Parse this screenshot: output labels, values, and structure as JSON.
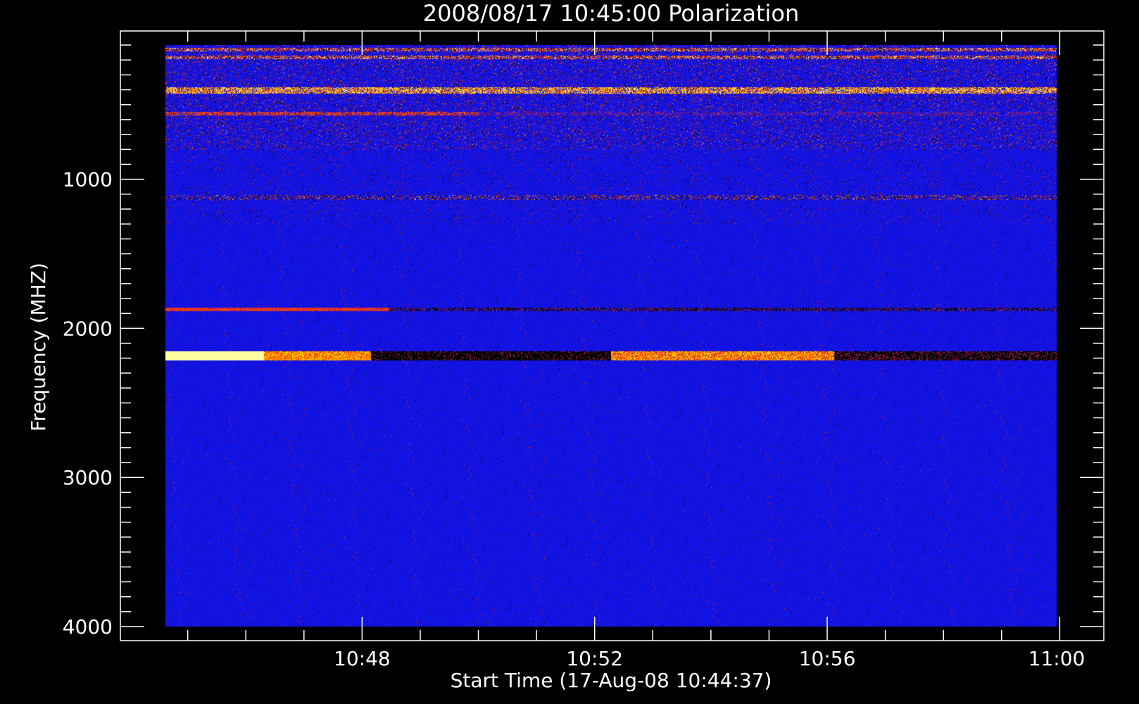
{
  "chart_data": {
    "type": "heatmap",
    "title": "2008/08/17 10:45:00 Polarization",
    "xlabel": "Start Time (17-Aug-08 10:44:37)",
    "ylabel": "Frequency (MHZ)",
    "x_start": "10:44:37",
    "x_end": "10:59:57",
    "x_range_minutes": [
      0,
      15.33
    ],
    "y_range_mhz": [
      100,
      4000
    ],
    "y_inverted": true,
    "x_ticks": [
      {
        "label": "10:48",
        "minutes": 3.383
      },
      {
        "label": "10:52",
        "minutes": 7.383
      },
      {
        "label": "10:56",
        "minutes": 11.383
      },
      {
        "label": "11:00",
        "minutes": 15.383
      }
    ],
    "y_ticks": [
      {
        "label": "1000",
        "mhz": 1000
      },
      {
        "label": "2000",
        "mhz": 2000
      },
      {
        "label": "3000",
        "mhz": 3000
      },
      {
        "label": "4000",
        "mhz": 4000
      }
    ],
    "background_color": "#1414f0",
    "colormap": [
      "#000000",
      "#1414f0",
      "#b02060",
      "#ff4400",
      "#ffd400",
      "#ffffa0"
    ],
    "features": [
      {
        "kind": "band",
        "mhz": 130,
        "intensity": "mixed"
      },
      {
        "kind": "band",
        "mhz": 180,
        "intensity": "mixed"
      },
      {
        "kind": "band",
        "mhz": 400,
        "intensity": "bright"
      },
      {
        "kind": "band",
        "mhz": 560,
        "intensity": "red"
      },
      {
        "kind": "band",
        "mhz": 1120,
        "intensity": "speckled"
      },
      {
        "kind": "band",
        "mhz": 1870,
        "intensity": "red-black"
      },
      {
        "kind": "band",
        "mhz": 2180,
        "intensity": "strong"
      }
    ]
  }
}
